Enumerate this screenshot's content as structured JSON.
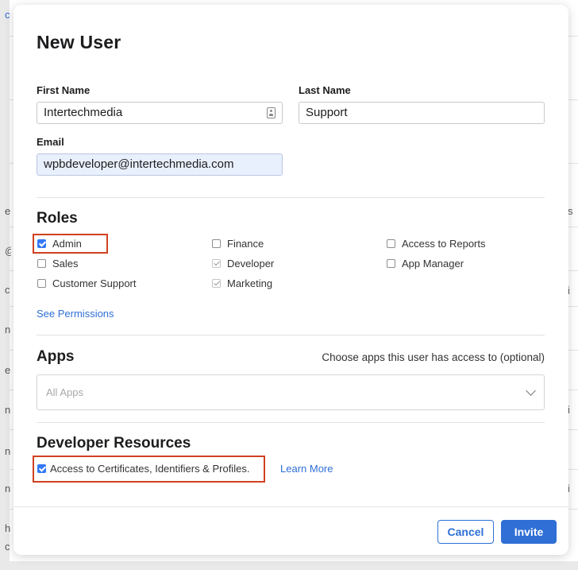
{
  "background": {
    "left_fragments": [
      "c",
      "e",
      "@",
      "c",
      "n",
      "e",
      "n",
      "n",
      "n",
      "h",
      "c"
    ],
    "right_fragments": [
      "s",
      "i",
      "i",
      "i"
    ]
  },
  "modal": {
    "title": "New User",
    "first_name": {
      "label": "First Name",
      "value": "Intertechmedia"
    },
    "last_name": {
      "label": "Last Name",
      "value": "Support"
    },
    "email": {
      "label": "Email",
      "value": "wpbdeveloper@intertechmedia.com"
    },
    "roles": {
      "heading": "Roles",
      "items": [
        {
          "label": "Admin",
          "checked": true,
          "disabled": false
        },
        {
          "label": "Sales",
          "checked": false,
          "disabled": false
        },
        {
          "label": "Customer Support",
          "checked": false,
          "disabled": false
        },
        {
          "label": "Finance",
          "checked": false,
          "disabled": false
        },
        {
          "label": "Developer",
          "checked": true,
          "disabled": true
        },
        {
          "label": "Marketing",
          "checked": true,
          "disabled": true
        },
        {
          "label": "Access to Reports",
          "checked": false,
          "disabled": false
        },
        {
          "label": "App Manager",
          "checked": false,
          "disabled": false
        }
      ],
      "see_permissions": "See Permissions"
    },
    "apps": {
      "heading": "Apps",
      "hint": "Choose apps this user has access to (optional)",
      "placeholder": "All Apps"
    },
    "developer_resources": {
      "heading": "Developer Resources",
      "checkbox_label": "Access to Certificates, Identifiers & Profiles.",
      "checked": true,
      "learn_more": "Learn More"
    },
    "buttons": {
      "cancel": "Cancel",
      "invite": "Invite"
    }
  },
  "colors": {
    "accent": "#2f6fd6",
    "highlight": "#d0411f",
    "autofill": "#e9f0fd"
  }
}
